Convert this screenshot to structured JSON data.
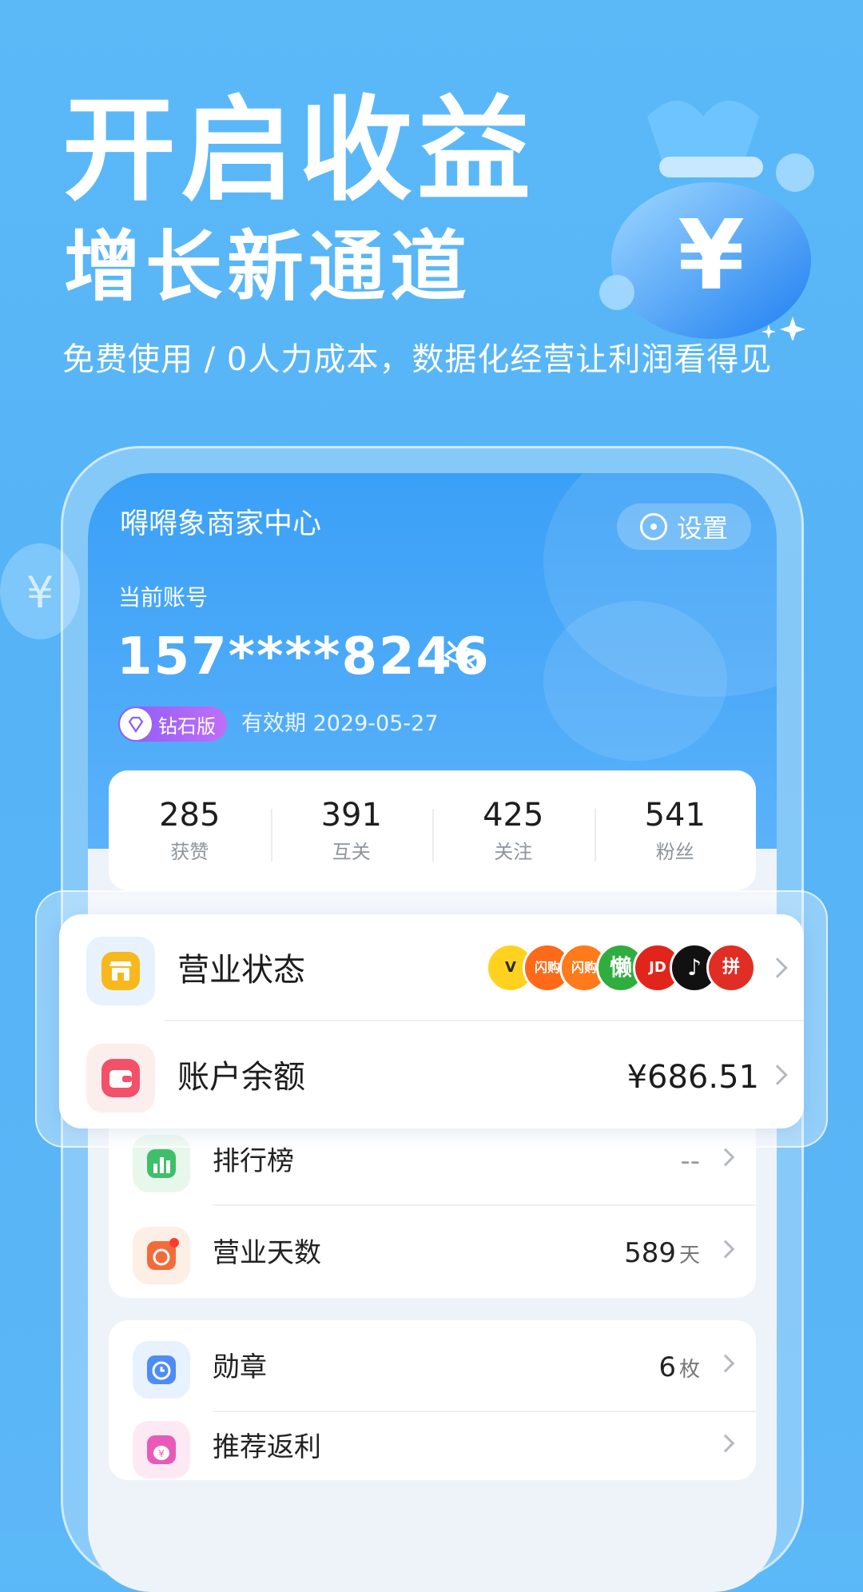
{
  "hero": {
    "title": "开启收益",
    "subtitle": "增长新通道",
    "tagline": "免费使用 / 0人力成本，数据化经营让利润看得见"
  },
  "app": {
    "title": "嘚嘚象商家中心",
    "settings_label": "设置",
    "account_label": "当前账号",
    "account_number": "157****8246",
    "vip_label": "钻石版",
    "expiry": "有效期 2029-05-27"
  },
  "stats": [
    {
      "value": "285",
      "label": "获赞"
    },
    {
      "value": "391",
      "label": "互关"
    },
    {
      "value": "425",
      "label": "关注"
    },
    {
      "value": "541",
      "label": "粉丝"
    }
  ],
  "panel": {
    "business_status": "营业状态",
    "balance_label": "账户余额",
    "balance_value": "¥686.51",
    "platforms": [
      {
        "name": "meituan",
        "text": "V",
        "color": "#ffd21f"
      },
      {
        "name": "taobao-shangou-fresh",
        "text": "闪购",
        "color": "#ff6a1a"
      },
      {
        "name": "taobao-shangou-food",
        "text": "闪购",
        "color": "#ff7a1a"
      },
      {
        "name": "lanren",
        "text": "懒",
        "color": "#2fae3f"
      },
      {
        "name": "jd",
        "text": "JD",
        "color": "#e1251b"
      },
      {
        "name": "douyin",
        "text": "♪",
        "color": "#111111"
      },
      {
        "name": "pinduoduo",
        "text": "拼",
        "color": "#e02e24"
      }
    ]
  },
  "rows": {
    "ranking_label": "排行榜",
    "ranking_value": "--",
    "days_label": "营业天数",
    "days_value": "589",
    "days_unit": "天",
    "medal_label": "勋章",
    "medal_value": "6",
    "medal_unit": "枚",
    "rebate_label": "推荐返利"
  },
  "colors": {
    "background": "#5cb9f8",
    "header": "#3aa0f7",
    "vip": "#8b5cf6"
  }
}
